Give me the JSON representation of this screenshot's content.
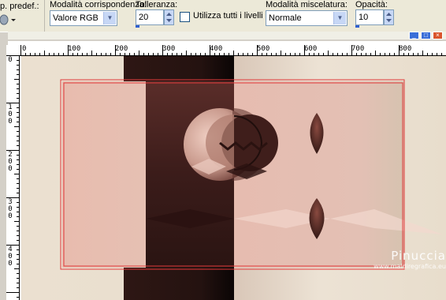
{
  "toolbar": {
    "preset_label": "p. predef.:",
    "match_mode": {
      "label": "Modalità corrispondenza:",
      "value": "Valore RGB"
    },
    "tolerance": {
      "label": "Tolleranza:",
      "value": "20"
    },
    "use_all_layers": {
      "label": "Utilizza tutti i livelli",
      "checked": false
    },
    "blend_mode": {
      "label": "Modalità miscelatura:",
      "value": "Normale"
    },
    "opacity": {
      "label": "Opacità:",
      "value": "10"
    }
  },
  "ruler": {
    "horizontal_labels": [
      "0",
      "100",
      "200",
      "300",
      "400",
      "500",
      "600",
      "700",
      "800"
    ],
    "vertical_labels": [
      "0",
      "100",
      "200",
      "300",
      "400"
    ]
  },
  "watermark": {
    "name": "Pinuccia",
    "url": "www.maidiregrafica.eu"
  },
  "colors": {
    "accent": "#2f5fd0",
    "selection": "#e03a3a",
    "dark_brown": "#3a1a17",
    "pink": "#e6bfb5"
  }
}
